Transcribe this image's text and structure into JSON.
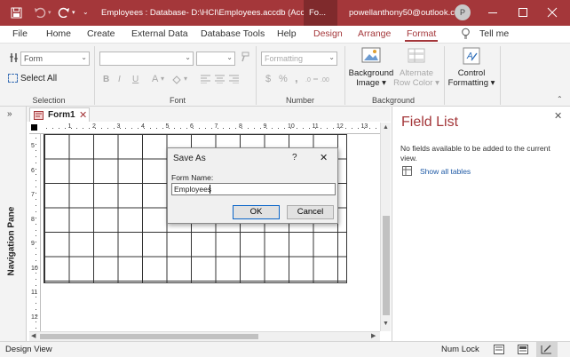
{
  "titlebar": {
    "title": "Employees : Database- D:\\HCI\\Employees.accdb (Acces...",
    "context_tab": "Fo...",
    "account": "powellanthony50@outlook.com",
    "avatar_letter": "P"
  },
  "tabs": [
    "File",
    "Home",
    "Create",
    "External Data",
    "Database Tools",
    "Help",
    "Design",
    "Arrange",
    "Format"
  ],
  "tell_me": "Tell me",
  "ribbon": {
    "selection": {
      "object_value": "Form",
      "select_all": "Select All",
      "label": "Selection"
    },
    "font": {
      "label": "Font",
      "bold": "B",
      "italic": "I",
      "underline": "U",
      "font_color": "A"
    },
    "number": {
      "format_value": "Formatting",
      "currency": "$",
      "percent": "%",
      "comma": ",",
      "label": "Number"
    },
    "background": {
      "image_label": "Background",
      "image_label2": "Image",
      "alt_row_label": "Alternate",
      "alt_row_label2": "Row Color",
      "label": "Background"
    },
    "control_formatting": {
      "line1": "Control",
      "line2": "Formatting"
    }
  },
  "document": {
    "tab_label": "Form1",
    "ruler_top": [
      "1",
      "2",
      "3",
      "4",
      "5",
      "6",
      "7",
      "8",
      "9",
      "10",
      "11",
      "12",
      "13"
    ],
    "ruler_left": [
      "5",
      "6",
      "7",
      "8",
      "9",
      "10",
      "11",
      "12"
    ]
  },
  "nav_pane_label": "Navigation Pane",
  "field_list": {
    "title": "Field List",
    "message": "No fields available to be added to the current view.",
    "link": "Show all tables"
  },
  "dialog": {
    "title": "Save As",
    "help": "?",
    "close": "✕",
    "field_label": "Form Name:",
    "field_value": "Employees",
    "ok": "OK",
    "cancel": "Cancel"
  },
  "status": {
    "left": "Design View",
    "num_lock": "Num Lock"
  },
  "colors": {
    "accent": "#a4373a",
    "titlebar": "#a4373a"
  }
}
